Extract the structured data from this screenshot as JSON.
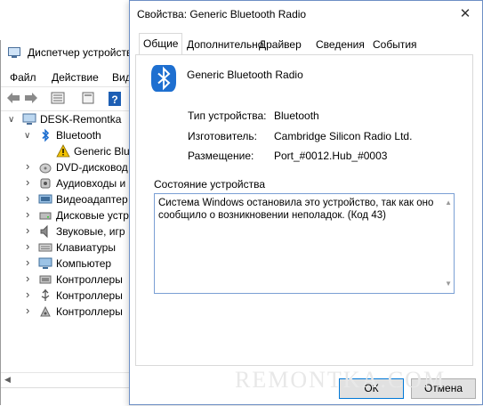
{
  "device_manager": {
    "title": "Диспетчер устройств",
    "menu": [
      "Файл",
      "Действие",
      "Вид"
    ],
    "tree": {
      "root": "DESK-Remontka",
      "bluetooth": "Bluetooth",
      "bt_child": "Generic Blu",
      "categories": [
        {
          "label": "DVD-дисковод",
          "icon": "dvd-drive-icon"
        },
        {
          "label": "Аудиовходы и",
          "icon": "audio-io-icon"
        },
        {
          "label": "Видеоадаптер",
          "icon": "display-adapter-icon"
        },
        {
          "label": "Дисковые устр",
          "icon": "disk-drive-icon"
        },
        {
          "label": "Звуковые, игр",
          "icon": "sound-controller-icon"
        },
        {
          "label": "Клавиатуры",
          "icon": "keyboard-icon"
        },
        {
          "label": "Компьютер",
          "icon": "computer-icon"
        },
        {
          "label": "Контроллеры",
          "icon": "controller-icon"
        },
        {
          "label": "Контроллеры",
          "icon": "usb-controller-icon"
        },
        {
          "label": "Контроллеры",
          "icon": "storage-controller-icon"
        }
      ]
    }
  },
  "dialog": {
    "title": "Свойства: Generic Bluetooth Radio",
    "close_label": "✕",
    "tabs": [
      "Общие",
      "Дополнительно",
      "Драйвер",
      "Сведения",
      "События"
    ],
    "active_tab": 0,
    "device_name": "Generic Bluetooth Radio",
    "properties": [
      {
        "label": "Тип устройства:",
        "value": "Bluetooth"
      },
      {
        "label": "Изготовитель:",
        "value": "Cambridge Silicon Radio Ltd."
      },
      {
        "label": "Размещение:",
        "value": "Port_#0012.Hub_#0003"
      }
    ],
    "status_label": "Состояние устройства",
    "status_text": "Система Windows остановила это устройство, так как оно сообщило о возникновении неполадок. (Код 43)",
    "ok_label": "ОК",
    "cancel_label": "Отмена"
  },
  "watermark": "REMONTKA.COM",
  "colors": {
    "bluetooth": "#1e6fd0",
    "accent_border": "#0078d7",
    "warning": "#f2c200"
  }
}
